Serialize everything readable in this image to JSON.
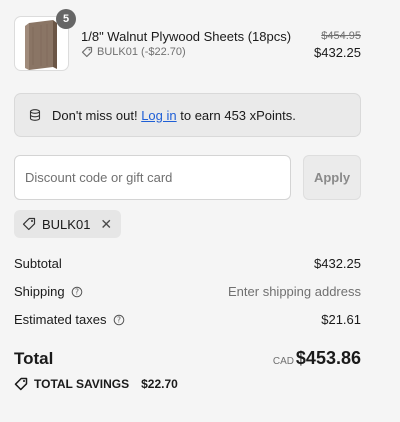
{
  "product": {
    "name": "1/8\" Walnut Plywood Sheets (18pcs)",
    "quantity": "5",
    "discount_label": "BULK01 (-$22.70)",
    "original_price": "$454.95",
    "price": "$432.25",
    "image_icon": "plywood-sheets-icon"
  },
  "points_banner": {
    "icon": "database-icon",
    "prefix": "Don't miss out!",
    "link_label": "Log in",
    "suffix": "to earn 453 xPoints."
  },
  "discount": {
    "placeholder": "Discount code or gift card",
    "apply_label": "Apply",
    "applied_code": "BULK01"
  },
  "summary": {
    "subtotal_label": "Subtotal",
    "subtotal_value": "$432.25",
    "shipping_label": "Shipping",
    "shipping_value": "Enter shipping address",
    "taxes_label": "Estimated taxes",
    "taxes_value": "$21.61",
    "total_label": "Total",
    "currency": "CAD",
    "total_value": "$453.86",
    "savings_label": "TOTAL SAVINGS",
    "savings_value": "$22.70"
  },
  "colors": {
    "link": "#1f5fd6",
    "background": "#f5f5f5"
  }
}
